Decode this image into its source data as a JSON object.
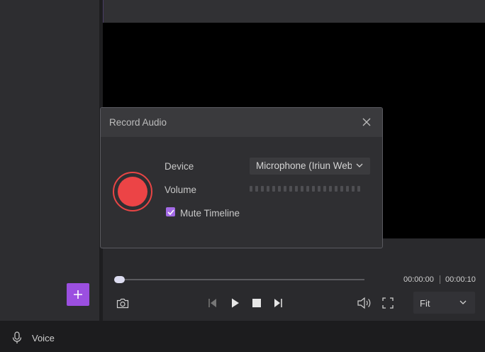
{
  "dialog": {
    "title": "Record Audio",
    "device_label": "Device",
    "device_value": "Microphone (Iriun Webcam)",
    "volume_label": "Volume",
    "volume_level": 0,
    "mute_timeline_label": "Mute Timeline",
    "mute_timeline_checked": true
  },
  "player": {
    "current_time": "00:00:00",
    "total_time": "00:00:10",
    "progress": 0,
    "zoom_value": "Fit"
  },
  "bottom_bar": {
    "voice_label": "Voice"
  },
  "colors": {
    "accent": "#9b4fe0",
    "record": "#ec4446",
    "checkbox": "#a36ae6",
    "background": "#2b2b2e"
  },
  "icons": [
    "plus-icon",
    "microphone-icon",
    "close-icon",
    "chevron-down-icon",
    "check-icon",
    "camera-icon",
    "prev-frame-icon",
    "play-icon",
    "stop-icon",
    "next-frame-icon",
    "speaker-icon",
    "fullscreen-icon"
  ]
}
